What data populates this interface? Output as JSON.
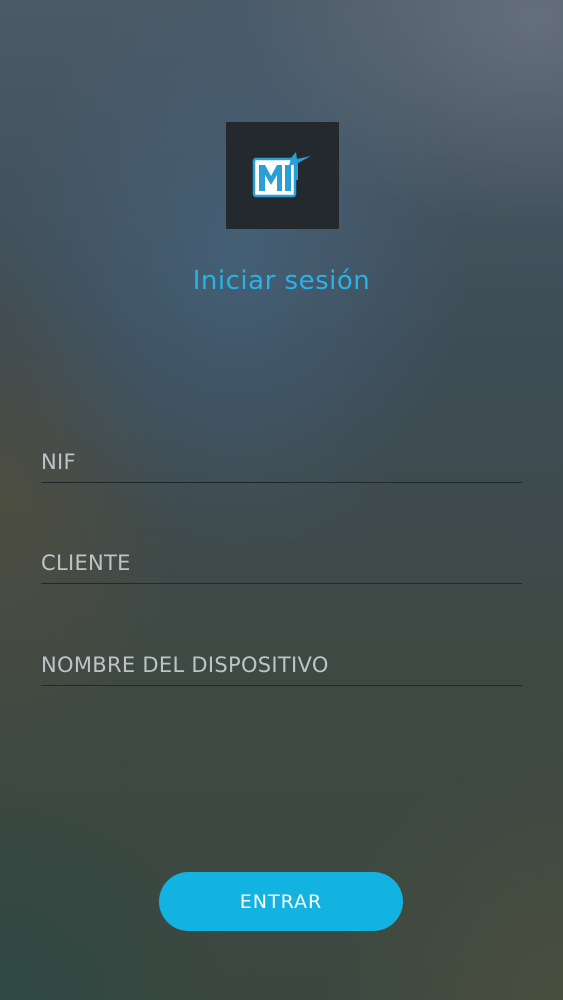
{
  "login": {
    "title": "Iniciar sesión",
    "fields": {
      "nif": {
        "placeholder": "NIF",
        "value": ""
      },
      "cliente": {
        "placeholder": "CLIENTE",
        "value": ""
      },
      "device_name": {
        "placeholder": "NOMBRE DEL DISPOSITIVO",
        "value": ""
      }
    },
    "submit_label": "ENTRAR"
  },
  "icons": {
    "logo": "app-logo-icon"
  },
  "colors": {
    "accent": "#27b3e6",
    "button": "#13b3e1",
    "logo_background": "#24292d"
  }
}
